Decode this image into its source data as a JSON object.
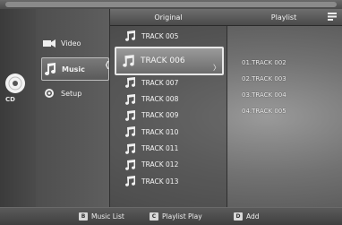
{
  "device_label": "CD",
  "menu": [
    {
      "label": "Video",
      "icon": "video-camera-icon"
    },
    {
      "label": "Music",
      "icon": "music-note-icon",
      "active": true
    },
    {
      "label": "Setup",
      "icon": "setup-icon"
    }
  ],
  "columns": {
    "original_header": "Original",
    "playlist_header": "Playlist"
  },
  "tracks": [
    "TRACK 005",
    "TRACK 006",
    "TRACK 007",
    "TRACK 008",
    "TRACK 009",
    "TRACK 010",
    "TRACK 011",
    "TRACK 012",
    "TRACK 013"
  ],
  "selected_track_index": 1,
  "playlist": [
    "01.TRACK 002",
    "02.TRACK 003",
    "03.TRACK 004",
    "04.TRACK 005"
  ],
  "footer": {
    "music_list_key": "B",
    "music_list_label": "Music List",
    "playlist_play_key": "C",
    "playlist_play_label": "Playlist Play",
    "add_key": "D",
    "add_label": "Add"
  }
}
